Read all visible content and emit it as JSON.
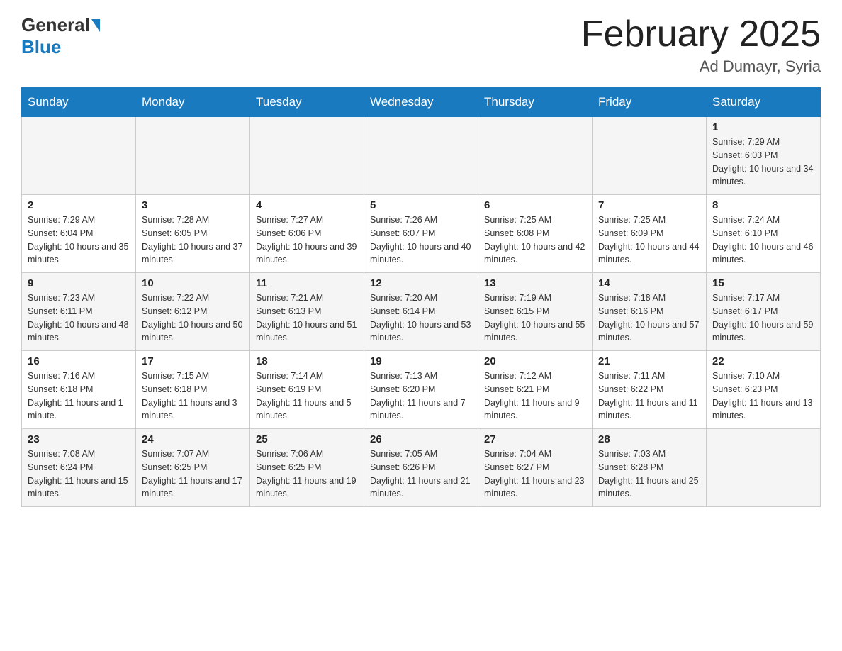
{
  "header": {
    "logo": {
      "general": "General",
      "blue": "Blue"
    },
    "title": "February 2025",
    "subtitle": "Ad Dumayr, Syria"
  },
  "days_of_week": [
    "Sunday",
    "Monday",
    "Tuesday",
    "Wednesday",
    "Thursday",
    "Friday",
    "Saturday"
  ],
  "weeks": [
    [
      {
        "day": "",
        "info": ""
      },
      {
        "day": "",
        "info": ""
      },
      {
        "day": "",
        "info": ""
      },
      {
        "day": "",
        "info": ""
      },
      {
        "day": "",
        "info": ""
      },
      {
        "day": "",
        "info": ""
      },
      {
        "day": "1",
        "info": "Sunrise: 7:29 AM\nSunset: 6:03 PM\nDaylight: 10 hours and 34 minutes."
      }
    ],
    [
      {
        "day": "2",
        "info": "Sunrise: 7:29 AM\nSunset: 6:04 PM\nDaylight: 10 hours and 35 minutes."
      },
      {
        "day": "3",
        "info": "Sunrise: 7:28 AM\nSunset: 6:05 PM\nDaylight: 10 hours and 37 minutes."
      },
      {
        "day": "4",
        "info": "Sunrise: 7:27 AM\nSunset: 6:06 PM\nDaylight: 10 hours and 39 minutes."
      },
      {
        "day": "5",
        "info": "Sunrise: 7:26 AM\nSunset: 6:07 PM\nDaylight: 10 hours and 40 minutes."
      },
      {
        "day": "6",
        "info": "Sunrise: 7:25 AM\nSunset: 6:08 PM\nDaylight: 10 hours and 42 minutes."
      },
      {
        "day": "7",
        "info": "Sunrise: 7:25 AM\nSunset: 6:09 PM\nDaylight: 10 hours and 44 minutes."
      },
      {
        "day": "8",
        "info": "Sunrise: 7:24 AM\nSunset: 6:10 PM\nDaylight: 10 hours and 46 minutes."
      }
    ],
    [
      {
        "day": "9",
        "info": "Sunrise: 7:23 AM\nSunset: 6:11 PM\nDaylight: 10 hours and 48 minutes."
      },
      {
        "day": "10",
        "info": "Sunrise: 7:22 AM\nSunset: 6:12 PM\nDaylight: 10 hours and 50 minutes."
      },
      {
        "day": "11",
        "info": "Sunrise: 7:21 AM\nSunset: 6:13 PM\nDaylight: 10 hours and 51 minutes."
      },
      {
        "day": "12",
        "info": "Sunrise: 7:20 AM\nSunset: 6:14 PM\nDaylight: 10 hours and 53 minutes."
      },
      {
        "day": "13",
        "info": "Sunrise: 7:19 AM\nSunset: 6:15 PM\nDaylight: 10 hours and 55 minutes."
      },
      {
        "day": "14",
        "info": "Sunrise: 7:18 AM\nSunset: 6:16 PM\nDaylight: 10 hours and 57 minutes."
      },
      {
        "day": "15",
        "info": "Sunrise: 7:17 AM\nSunset: 6:17 PM\nDaylight: 10 hours and 59 minutes."
      }
    ],
    [
      {
        "day": "16",
        "info": "Sunrise: 7:16 AM\nSunset: 6:18 PM\nDaylight: 11 hours and 1 minute."
      },
      {
        "day": "17",
        "info": "Sunrise: 7:15 AM\nSunset: 6:18 PM\nDaylight: 11 hours and 3 minutes."
      },
      {
        "day": "18",
        "info": "Sunrise: 7:14 AM\nSunset: 6:19 PM\nDaylight: 11 hours and 5 minutes."
      },
      {
        "day": "19",
        "info": "Sunrise: 7:13 AM\nSunset: 6:20 PM\nDaylight: 11 hours and 7 minutes."
      },
      {
        "day": "20",
        "info": "Sunrise: 7:12 AM\nSunset: 6:21 PM\nDaylight: 11 hours and 9 minutes."
      },
      {
        "day": "21",
        "info": "Sunrise: 7:11 AM\nSunset: 6:22 PM\nDaylight: 11 hours and 11 minutes."
      },
      {
        "day": "22",
        "info": "Sunrise: 7:10 AM\nSunset: 6:23 PM\nDaylight: 11 hours and 13 minutes."
      }
    ],
    [
      {
        "day": "23",
        "info": "Sunrise: 7:08 AM\nSunset: 6:24 PM\nDaylight: 11 hours and 15 minutes."
      },
      {
        "day": "24",
        "info": "Sunrise: 7:07 AM\nSunset: 6:25 PM\nDaylight: 11 hours and 17 minutes."
      },
      {
        "day": "25",
        "info": "Sunrise: 7:06 AM\nSunset: 6:25 PM\nDaylight: 11 hours and 19 minutes."
      },
      {
        "day": "26",
        "info": "Sunrise: 7:05 AM\nSunset: 6:26 PM\nDaylight: 11 hours and 21 minutes."
      },
      {
        "day": "27",
        "info": "Sunrise: 7:04 AM\nSunset: 6:27 PM\nDaylight: 11 hours and 23 minutes."
      },
      {
        "day": "28",
        "info": "Sunrise: 7:03 AM\nSunset: 6:28 PM\nDaylight: 11 hours and 25 minutes."
      },
      {
        "day": "",
        "info": ""
      }
    ]
  ]
}
